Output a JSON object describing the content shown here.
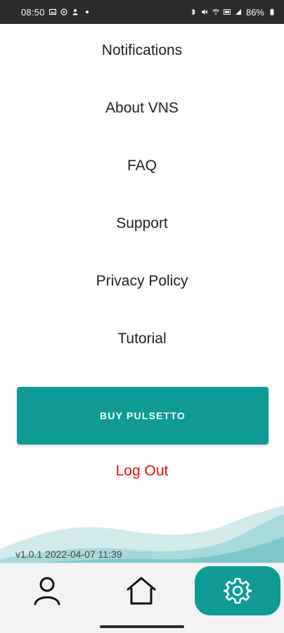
{
  "status_bar": {
    "time": "08:50",
    "battery": "86%"
  },
  "menu": {
    "items": [
      {
        "label": "Notifications"
      },
      {
        "label": "About VNS"
      },
      {
        "label": "FAQ"
      },
      {
        "label": "Support"
      },
      {
        "label": "Privacy Policy"
      },
      {
        "label": "Tutorial"
      }
    ]
  },
  "buy_button": {
    "label": "BUY PULSETTO"
  },
  "logout": {
    "label": "Log Out"
  },
  "version": "v1.0.1 2022-04-07 11:39",
  "bottom_nav": {
    "items": [
      {
        "icon": "person-icon",
        "active": false
      },
      {
        "icon": "home-icon",
        "active": false
      },
      {
        "icon": "gear-icon",
        "active": true
      }
    ]
  },
  "colors": {
    "accent": "#0f9a96",
    "logout": "#e10f0f",
    "wave_light": "#cfe9e9",
    "wave_mid": "#8fcfd0"
  }
}
